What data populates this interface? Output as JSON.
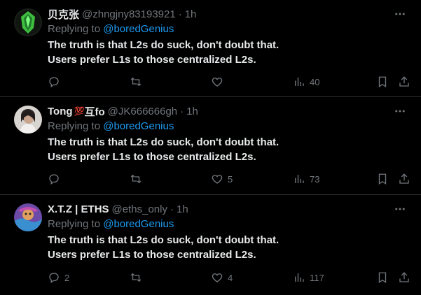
{
  "tweets": [
    {
      "name": "贝克张",
      "handle": "@zhngjny83193921",
      "dot": "·",
      "time": "1h",
      "replying_prefix": "Replying to",
      "replying_to": "@boredGenius",
      "text_line1": "The truth is that L2s do suck, don't doubt that.",
      "text_line2": "Users prefer L1s to those centralized L2s.",
      "reply_count": "",
      "retweet_count": "",
      "like_count": "",
      "view_count": "40"
    },
    {
      "name": "Tong",
      "name_suffix": "互fo",
      "badge": "💯",
      "handle": "@JK666666gh",
      "dot": "·",
      "time": "1h",
      "replying_prefix": "Replying to",
      "replying_to": "@boredGenius",
      "text_line1": "The truth is that L2s do suck, don't doubt that.",
      "text_line2": "Users prefer L1s to those centralized L2s.",
      "reply_count": "",
      "retweet_count": "",
      "like_count": "5",
      "view_count": "73"
    },
    {
      "name": "X.T.Z | ETHS",
      "handle": "@eths_only",
      "dot": "·",
      "time": "1h",
      "replying_prefix": "Replying to",
      "replying_to": "@boredGenius",
      "text_line1": "The truth is that L2s do suck, don't doubt that.",
      "text_line2": "Users prefer L1s to those centralized L2s.",
      "reply_count": "2",
      "retweet_count": "",
      "like_count": "4",
      "view_count": "117"
    }
  ],
  "colors": {
    "background": "#000000",
    "text": "#e7e9ea",
    "muted": "#71767b",
    "link": "#1d9bf0",
    "divider": "#2f3336"
  }
}
